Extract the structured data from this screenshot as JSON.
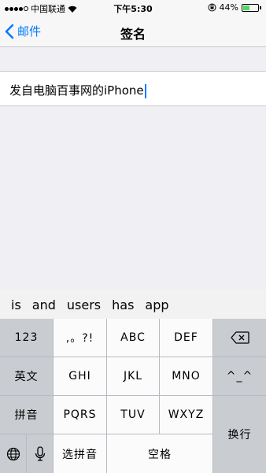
{
  "status": {
    "carrier": "中国联通",
    "time": "下午5:30",
    "battery_percent_label": "44%",
    "battery_level": 0.44
  },
  "nav": {
    "back_label": "邮件",
    "title": "签名"
  },
  "signature": {
    "text": "发自电脑百事网的iPhone"
  },
  "keyboard": {
    "predictions": [
      "is",
      "and",
      "users",
      "has",
      "app"
    ],
    "keys": {
      "num": "123",
      "punct": ",。?!",
      "abc": "ABC",
      "def": "DEF",
      "english": "英文",
      "ghi": "GHI",
      "jkl": "JKL",
      "mno": "MNO",
      "emoticon": "^_^",
      "pinyin": "拼音",
      "pqrs": "PQRS",
      "tuv": "TUV",
      "wxyz": "WXYZ",
      "newline": "换行",
      "select_pinyin": "选拼音",
      "space": "空格"
    }
  },
  "colors": {
    "accent": "#007aff",
    "battery_fill": "#4cd964"
  },
  "icons": [
    "signal-dots-icon",
    "wifi-icon",
    "chevron-left-icon",
    "orientation-lock-icon",
    "battery-icon",
    "delete-icon",
    "globe-icon",
    "microphone-icon"
  ]
}
